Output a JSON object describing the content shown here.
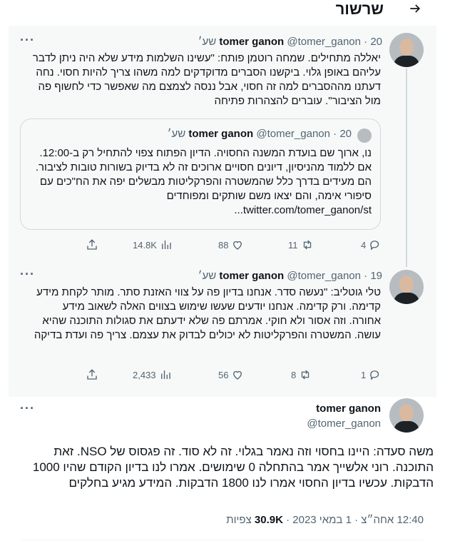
{
  "header": {
    "title": "שרשור",
    "back_icon": "arrow-right-icon"
  },
  "tweets": [
    {
      "name": "tomer ganon",
      "handle": "@tomer_ganon",
      "time": "20 שע׳",
      "text": "יאללה מתחילים. שמחה רוטמן פותח: \"עשינו השלמות מידע שלא היה ניתן לדבר עליהם באופן גלוי. ביקשנו הסברים מדוקדקים למה משהו צריך להיות חסוי. נחה דעתנו מההסברים למה זה חסוי, אבל ננסה לצמצם מה שאפשר כדי לחשוף פה מול הציבור\". עוברים להצהרות פתיחה",
      "quote": {
        "name": "tomer ganon",
        "handle": "@tomer_ganon",
        "time": "20 שע׳",
        "text": "נו, ארוך שם בועדת המשנה החסויה. הדיון הפתוח צפוי להתחיל רק ב-12:00. אם ללמוד מהניסיון, דיונים חסויים ארוכים זה לא בדיוק בשורות טובות לציבור. הם מעידים בדרך כלל שהמשטרה והפרקליטות מבשלים יפה את הח\"כים עם סיפורי אימה, והם יצאו משם שותקים ומפוחדים",
        "link": "twitter.com/tomer_ganon/st..."
      },
      "replies": "4",
      "retweets": "11",
      "likes": "88",
      "views": "14.8K"
    },
    {
      "name": "tomer ganon",
      "handle": "@tomer_ganon",
      "time": "19 שע׳",
      "text": "טלי גוטליב: \"נעשה סדר. אנחנו בדיון פה על צווי האזנת סתר. מותר לקחת מידע קדימה. ורק קדימה. אנחנו יודעים שעשו שימוש בצווים האלה לשאוב מידע אחורה. וזה אסור ולא חוקי. אמרתם פה שלא ידעתם את סגולות התוכנה שהיא עושה. המשטרה והפרקליטות לא יכולים לבדוק את עצמם. צריך פה ועדת בדיקה",
      "replies": "1",
      "retweets": "8",
      "likes": "56",
      "views": "2,433"
    }
  ],
  "main": {
    "name": "tomer ganon",
    "handle": "@tomer_ganon",
    "text": "משה סעדה: היינו בחסוי וזה נאמר בגלוי. זה לא סוד. זה פגסוס של NSO. זאת התוכנה. רוני אלשייך אמר בהתחלה 0 שימושים. אמרו לנו בדיון הקודם שהיו 1000 הדבקות. עכשיו בדיון החסוי אמרו לנו 1800 הדבקות. המידע מגיע בחלקים",
    "time": "12:40 אחה״צ",
    "date": "1 במאי 2023",
    "views_count": "30.9K",
    "views_label": "צפיות"
  },
  "more_label": "···"
}
